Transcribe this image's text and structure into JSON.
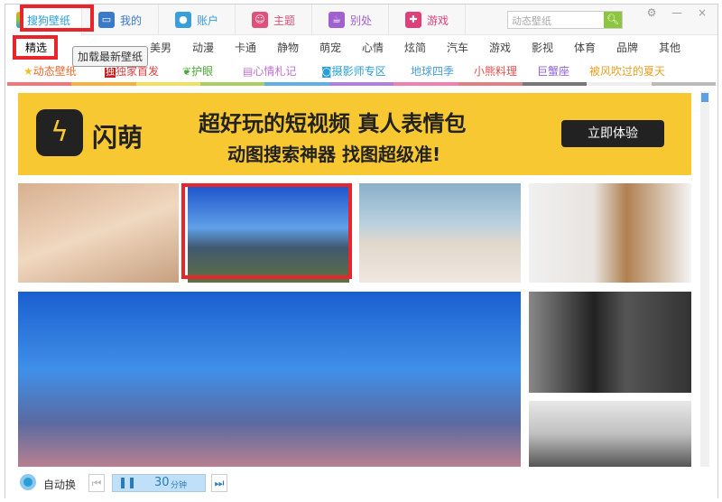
{
  "tabs": [
    {
      "label": "搜狗壁纸",
      "color": "#2a9fd6"
    },
    {
      "label": "我的",
      "color": "#3a7ac8"
    },
    {
      "label": "账户",
      "color": "#3a9fd8"
    },
    {
      "label": "主题",
      "color": "#e0507a"
    },
    {
      "label": "别处",
      "color": "#a060d0"
    },
    {
      "label": "游戏",
      "color": "#e0407a"
    }
  ],
  "search": {
    "placeholder": "动态壁纸"
  },
  "window_controls": {
    "settings": "⚙",
    "minimize": "—",
    "close": "×"
  },
  "categories": [
    "精选",
    "美男",
    "动漫",
    "卡通",
    "静物",
    "萌宠",
    "心情",
    "炫简",
    "汽车",
    "游戏",
    "影视",
    "体育",
    "品牌",
    "其他"
  ],
  "tooltip": "加载最新壁纸",
  "subcategories": [
    {
      "label": "动态壁纸",
      "color": "#e86a2a"
    },
    {
      "label": "独家首发",
      "color": "#e04040"
    },
    {
      "label": "护眼",
      "color": "#4aa838"
    },
    {
      "label": "心情札记",
      "color": "#c070d0"
    },
    {
      "label": "摄影师专区",
      "color": "#2a9fd6"
    },
    {
      "label": "地球四季",
      "color": "#4aa0d8"
    },
    {
      "label": "小熊料理",
      "color": "#e05050"
    },
    {
      "label": "巨蟹座",
      "color": "#9060d8"
    },
    {
      "label": "被风吹过的夏天",
      "color": "#e8a020"
    }
  ],
  "banner": {
    "brand": "闪萌",
    "headline": "超好玩的短视频 真人表情包",
    "subline": "动图搜索神器 找图超级准!",
    "cta": "立即体验"
  },
  "bottom": {
    "auto_change": "自动换",
    "interval": "30",
    "interval_unit": "分钟"
  }
}
